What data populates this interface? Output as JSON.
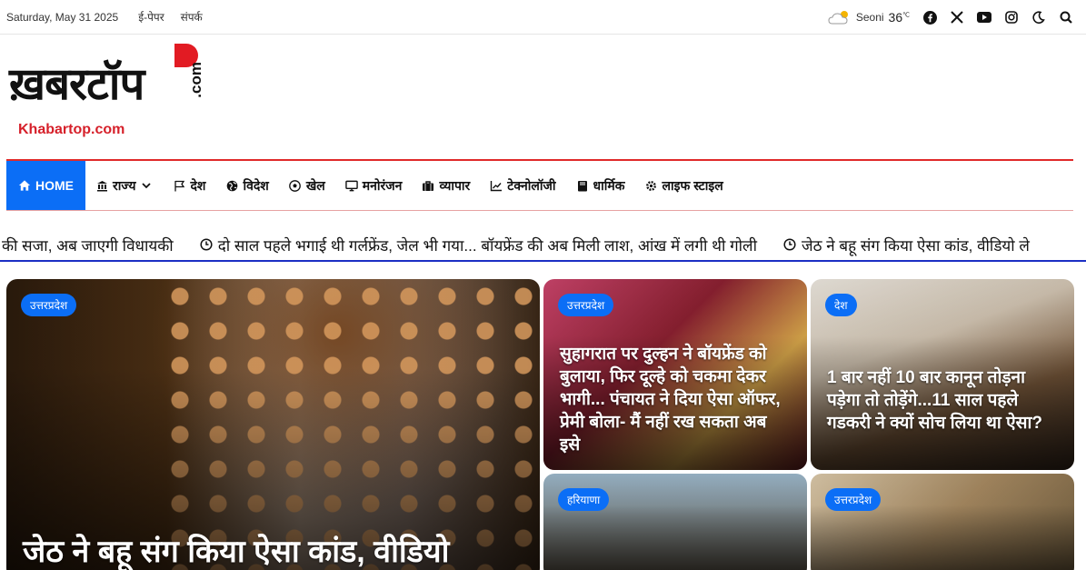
{
  "topbar": {
    "date": "Saturday, May 31 2025",
    "links": [
      "ई-पेपर",
      "संपर्क"
    ],
    "weather": {
      "city": "Seoni",
      "temp": "36",
      "unit": "℃"
    },
    "icons": [
      "cloud-sun-icon",
      "facebook-icon",
      "x-icon",
      "youtube-icon",
      "instagram-icon",
      "moon-icon",
      "search-icon"
    ]
  },
  "logo": {
    "brand": "ख़बरटॉप",
    "dotcom": ".com",
    "url": "Khabartop.com"
  },
  "nav": [
    {
      "label": "HOME",
      "icon": "home-icon",
      "active": true
    },
    {
      "label": "राज्य",
      "icon": "landmark-icon",
      "dropdown": true
    },
    {
      "label": "देश",
      "icon": "flag-icon"
    },
    {
      "label": "विदेश",
      "icon": "globe-icon"
    },
    {
      "label": "खेल",
      "icon": "football-icon"
    },
    {
      "label": "मनोरंजन",
      "icon": "monitor-icon"
    },
    {
      "label": "व्यापार",
      "icon": "briefcase-icon"
    },
    {
      "label": "टेक्नोलॉजी",
      "icon": "chart-icon"
    },
    {
      "label": "धार्मिक",
      "icon": "book-icon"
    },
    {
      "label": "लाइफ स्टाइल",
      "icon": "cog-icon"
    }
  ],
  "ticker": [
    "की सजा, अब जाएगी विधायकी",
    "दो साल पहले भगाई थी गर्लफ्रेंड, जेल भी गया... बॉयफ्रेंड की अब मिली लाश, आंख में लगी थी गोली",
    "जेठ ने बहू संग किया ऐसा कांड, वीडियो ले"
  ],
  "cards": [
    {
      "category": "उत्तरप्रदेश",
      "title": "जेठ ने बहू संग किया ऐसा कांड, वीडियो"
    },
    {
      "category": "उत्तरप्रदेश",
      "title": "सुहागरात पर दुल्हन ने बॉयफ्रेंड को बुलाया, फिर दूल्हे को चकमा देकर भागी... पंचायत ने दिया ऐसा ऑफर, प्रेमी बोला- मैं नहीं रख सकता अब इसे"
    },
    {
      "category": "देश",
      "title": "1 बार नहीं 10 बार कानून तोड़ना पड़ेगा तो तोड़ेंगे...11 साल पहले गडकरी ने क्यों सोच लिया था ऐसा?"
    },
    {
      "category": "हरियाणा",
      "title": ""
    },
    {
      "category": "उत्तरप्रदेश",
      "title": ""
    }
  ]
}
